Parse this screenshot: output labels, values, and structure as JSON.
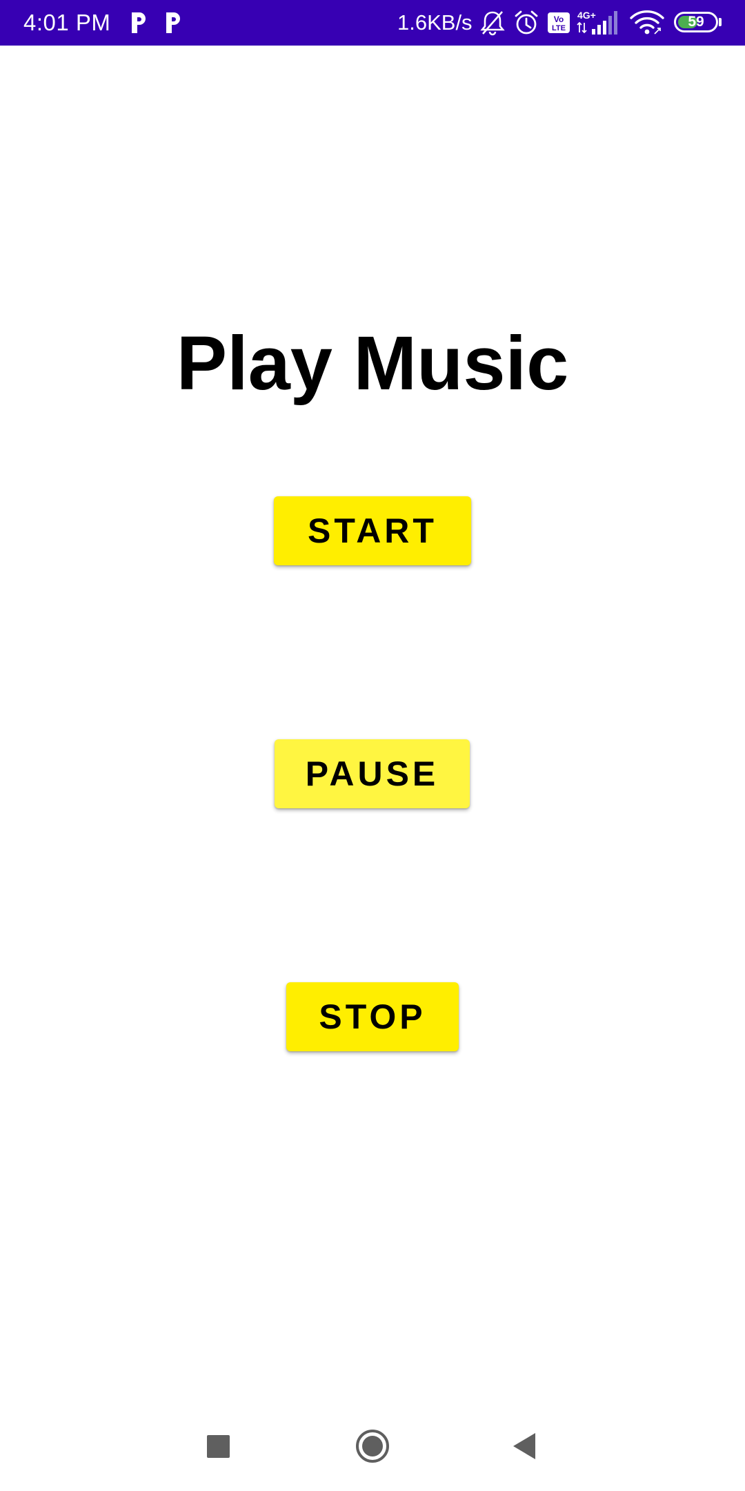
{
  "status_bar": {
    "time": "4:01 PM",
    "notification_icons": [
      "p-app-icon",
      "p-app-icon"
    ],
    "network_speed": "1.6KB/s",
    "icons": [
      "bell-muted-icon",
      "alarm-icon",
      "volte-icon",
      "4g-signal-icon",
      "wifi-icon"
    ],
    "network_type": "4G+",
    "volte_label": "Vo LTE",
    "battery_level": "59",
    "battery_percent": 59,
    "colors": {
      "background": "#3700b3",
      "battery_fill": "#4caf50"
    }
  },
  "main": {
    "title": "Play Music",
    "buttons": {
      "start": "START",
      "pause": "PAUSE",
      "stop": "STOP"
    },
    "colors": {
      "button": "#ffee00",
      "button_pressed": "#fff541"
    }
  },
  "nav_bar": {
    "items": [
      "recents-square-icon",
      "home-circle-icon",
      "back-triangle-icon"
    ]
  }
}
